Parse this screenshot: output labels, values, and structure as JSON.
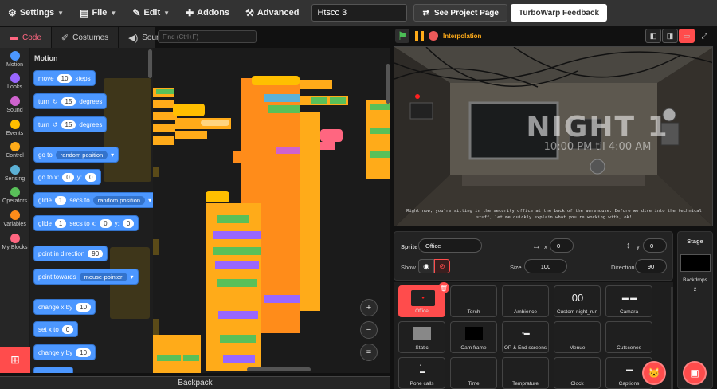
{
  "menubar": {
    "settings": "Settings",
    "file": "File",
    "edit": "Edit",
    "addons": "Addons",
    "advanced": "Advanced",
    "project_title": "Htscc 3",
    "see_project": "See Project Page",
    "feedback": "TurboWarp Feedback"
  },
  "tabs": {
    "code": "Code",
    "costumes": "Costumes",
    "sounds": "Sounds"
  },
  "find_placeholder": "Find (Ctrl+F)",
  "categories": [
    {
      "label": "Motion",
      "color": "#4c97ff"
    },
    {
      "label": "Looks",
      "color": "#9966ff"
    },
    {
      "label": "Sound",
      "color": "#cf63cf"
    },
    {
      "label": "Events",
      "color": "#ffbf00"
    },
    {
      "label": "Control",
      "color": "#ffab19"
    },
    {
      "label": "Sensing",
      "color": "#5cb1d6"
    },
    {
      "label": "Operators",
      "color": "#59c059"
    },
    {
      "label": "Variables",
      "color": "#ff8c1a"
    },
    {
      "label": "My Blocks",
      "color": "#ff6680"
    }
  ],
  "palette": {
    "title": "Motion",
    "blocks": {
      "move": "move",
      "move_val": "10",
      "steps": "steps",
      "turn": "turn",
      "turn_r_val": "15",
      "degrees": "degrees",
      "turn_l_val": "15",
      "goto": "go to",
      "random_position": "random position",
      "goto_x": "go to x:",
      "goto_x_val": "0",
      "y": "y:",
      "goto_y_val": "0",
      "glide": "glide",
      "glide_val": "1",
      "secs_to": "secs to",
      "glide2_val": "1",
      "secs_to_x": "secs to x:",
      "glide_x_val": "0",
      "glide_y_val": "0",
      "point_dir": "point in direction",
      "dir_val": "90",
      "point_towards": "point towards",
      "mouse_pointer": "mouse-pointer",
      "change_x": "change x by",
      "change_x_val": "10",
      "set_x": "set x to",
      "set_x_val": "0",
      "change_y": "change y by",
      "change_y_val": "10"
    }
  },
  "zoom": {
    "in": "+",
    "out": "−",
    "reset": "="
  },
  "backpack": "Backpack",
  "stage_header": {
    "interpolation": "Interpolation"
  },
  "stage": {
    "title": "NIGHT 1",
    "subtitle": "10:00 PM til 4:00 AM",
    "caption": "Right now, you're sitting in the security office at the back of the warehouse. Before we dive into the technical stuff, let me quickly explain what you're working with, ok!"
  },
  "sprite_info": {
    "sprite_label": "Sprite",
    "sprite_name": "Office",
    "x_label": "x",
    "x_val": "0",
    "y_label": "y",
    "y_val": "0",
    "show_label": "Show",
    "size_label": "Size",
    "size_val": "100",
    "direction_label": "Direction",
    "direction_val": "90"
  },
  "sprites": [
    {
      "name": "Office"
    },
    {
      "name": "Torch"
    },
    {
      "name": "Ambience"
    },
    {
      "name": "Custom night_run"
    },
    {
      "name": "Camara"
    },
    {
      "name": "Static"
    },
    {
      "name": "Cam frame"
    },
    {
      "name": "OP & End screens"
    },
    {
      "name": "Menue"
    },
    {
      "name": "Cutscenes"
    },
    {
      "name": "Pone calls"
    },
    {
      "name": "Time"
    },
    {
      "name": "Temprature"
    },
    {
      "name": "Clock"
    },
    {
      "name": "Captions"
    }
  ],
  "stage_panel": {
    "title": "Stage",
    "backdrops_label": "Backdrops",
    "backdrops_count": "2"
  }
}
